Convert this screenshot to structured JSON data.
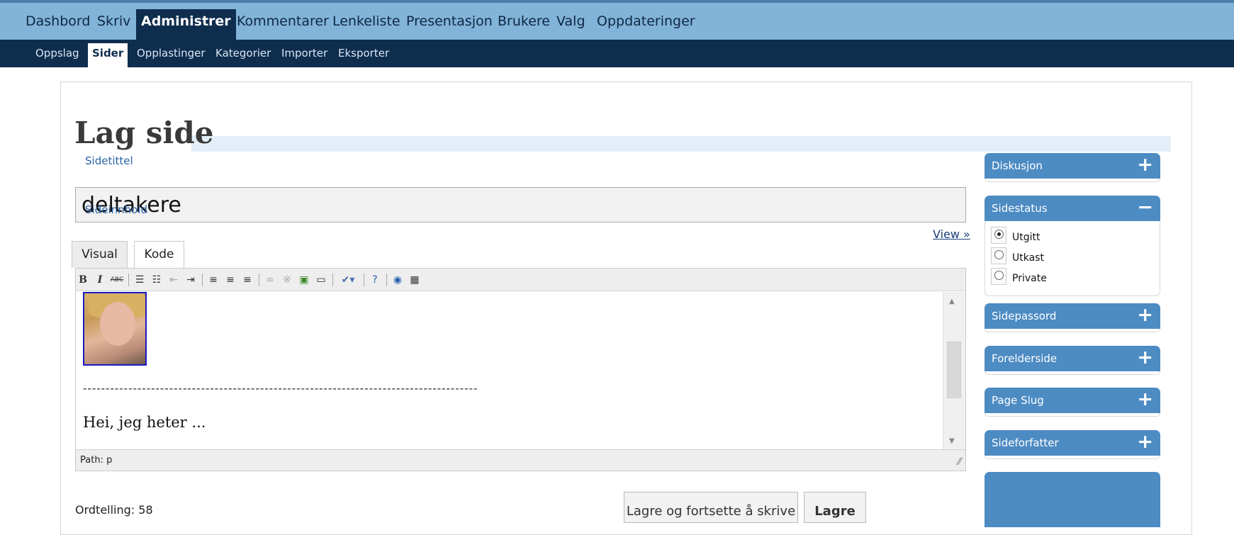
{
  "top_nav": {
    "items": [
      "Dashbord",
      "Skriv",
      "Administrer",
      "Kommentarer",
      "Lenkeliste",
      "Presentasjon",
      "Brukere",
      "Valg",
      "Oppdateringer"
    ],
    "active": "Administrer"
  },
  "sub_nav": {
    "items": [
      "Oppslag",
      "Sider",
      "Opplastinger",
      "Kategorier",
      "Importer",
      "Eksporter"
    ],
    "active": "Sider"
  },
  "page": {
    "title": "Lag side",
    "title_label": "Sidetittel",
    "title_value": "deltakere",
    "content_label": "Sideinnhold",
    "view_link": "View »"
  },
  "editor": {
    "tabs": [
      "Visual",
      "Kode"
    ],
    "active_tab": "Visual",
    "toolbar_icons": [
      "bold-icon",
      "italic-icon",
      "strikethrough-icon",
      "bullet-list-icon",
      "numbered-list-icon",
      "outdent-icon",
      "indent-icon",
      "align-left-icon",
      "align-center-icon",
      "align-right-icon",
      "link-icon",
      "unlink-icon",
      "image-icon",
      "more-icon",
      "spellcheck-icon",
      "help-icon",
      "adv-toggle-icon",
      "kitchen-sink-icon"
    ],
    "dashes": "---------------------------------------------------------------------------------------",
    "body_text": "Hei, jeg heter ...",
    "path": "Path: p"
  },
  "footer": {
    "word_count": "Ordtelling: 58",
    "save_continue": "Lagre og fortsette å skrive",
    "save": "Lagre"
  },
  "sidebar": {
    "discussion": "Diskusjon",
    "status": "Sidestatus",
    "status_options": [
      "Utgitt",
      "Utkast",
      "Private"
    ],
    "status_selected": "Utgitt",
    "password": "Sidepassord",
    "parent": "Forelderside",
    "slug": "Page Slug",
    "author": "Sideforfatter"
  },
  "colors": {
    "top_nav_bg": "#82b3d9",
    "sub_nav_bg": "#0f2d4d",
    "sidebar_head": "#4d8bc3",
    "label_blue": "#2a64a8"
  }
}
